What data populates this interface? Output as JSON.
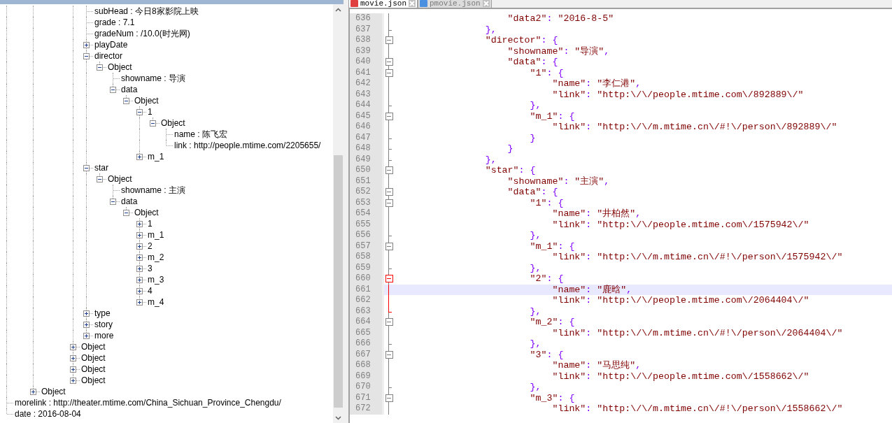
{
  "tree": [
    {
      "children": [
        {
          "children": [
            {
              "children": [
                {
                  "children": [
                    {
                      "children": [
                        {
                          "children": [
                            {
                              "label": "subHead : 今日8家影院上映"
                            },
                            {
                              "label": "grade : 7.1"
                            },
                            {
                              "label": "gradeNum : /10.0(时光网)"
                            },
                            {
                              "label": "playDate",
                              "expanded": false
                            },
                            {
                              "label": "director",
                              "expanded": true,
                              "children": [
                                {
                                  "label": "Object",
                                  "expanded": true,
                                  "children": [
                                    {
                                      "label": "showname : 导演"
                                    },
                                    {
                                      "label": "data",
                                      "expanded": true,
                                      "children": [
                                        {
                                          "label": "Object",
                                          "expanded": true,
                                          "children": [
                                            {
                                              "label": "1",
                                              "expanded": true,
                                              "children": [
                                                {
                                                  "label": "Object",
                                                  "expanded": true,
                                                  "children": [
                                                    {
                                                      "label": "name : 陈飞宏"
                                                    },
                                                    {
                                                      "label": "link : http://people.mtime.com/2205655/"
                                                    }
                                                  ]
                                                }
                                              ]
                                            },
                                            {
                                              "label": "m_1",
                                              "expanded": false
                                            }
                                          ]
                                        }
                                      ]
                                    }
                                  ]
                                }
                              ]
                            },
                            {
                              "label": "star",
                              "expanded": true,
                              "children": [
                                {
                                  "label": "Object",
                                  "expanded": true,
                                  "children": [
                                    {
                                      "label": "showname : 主演"
                                    },
                                    {
                                      "label": "data",
                                      "expanded": true,
                                      "children": [
                                        {
                                          "label": "Object",
                                          "expanded": true,
                                          "children": [
                                            {
                                              "label": "1",
                                              "expanded": false
                                            },
                                            {
                                              "label": "m_1",
                                              "expanded": false
                                            },
                                            {
                                              "label": "2",
                                              "expanded": false
                                            },
                                            {
                                              "label": "m_2",
                                              "expanded": false
                                            },
                                            {
                                              "label": "3",
                                              "expanded": false
                                            },
                                            {
                                              "label": "m_3",
                                              "expanded": false
                                            },
                                            {
                                              "label": "4",
                                              "expanded": false
                                            },
                                            {
                                              "label": "m_4",
                                              "expanded": false
                                            }
                                          ]
                                        }
                                      ]
                                    }
                                  ]
                                }
                              ]
                            },
                            {
                              "label": "type",
                              "expanded": false
                            },
                            {
                              "label": "story",
                              "expanded": false
                            },
                            {
                              "label": "more",
                              "expanded": false
                            }
                          ]
                        },
                        {
                          "label": "Object",
                          "expanded": false
                        },
                        {
                          "label": "Object",
                          "expanded": false
                        },
                        {
                          "label": "Object",
                          "expanded": false
                        },
                        {
                          "label": "Object",
                          "expanded": false
                        }
                      ]
                    }
                  ]
                }
              ]
            },
            {
              "label": "Object",
              "expanded": false
            }
          ]
        }
      ]
    },
    {
      "label": "morelink : http://theater.mtime.com/China_Sichuan_Province_Chengdu/"
    },
    {
      "label": "date : 2016-08-04"
    }
  ],
  "tabs": [
    {
      "label": "movie.json",
      "selected": true
    },
    {
      "label": "pmovie.json",
      "selected": false
    }
  ],
  "lines": [
    {
      "number": "636",
      "kind": "line",
      "text": "                    \"data2\": \"2016-8-5\""
    },
    {
      "number": "637",
      "kind": "end",
      "text": "                },"
    },
    {
      "number": "638",
      "kind": "box",
      "text": "                \"director\": {"
    },
    {
      "number": "639",
      "kind": "line",
      "text": "                    \"showname\": \"导演\","
    },
    {
      "number": "640",
      "kind": "box",
      "text": "                    \"data\": {"
    },
    {
      "number": "641",
      "kind": "box",
      "text": "                        \"1\": {"
    },
    {
      "number": "642",
      "kind": "line",
      "text": "                            \"name\": \"李仁港\","
    },
    {
      "number": "643",
      "kind": "line",
      "text": "                            \"link\": \"http:\\/\\/people.mtime.com\\/892889\\/\""
    },
    {
      "number": "644",
      "kind": "end",
      "text": "                        },"
    },
    {
      "number": "645",
      "kind": "box",
      "text": "                        \"m_1\": {"
    },
    {
      "number": "646",
      "kind": "line",
      "text": "                            \"link\": \"http:\\/\\/m.mtime.cn\\/#!\\/person\\/892889\\/\""
    },
    {
      "number": "647",
      "kind": "end",
      "text": "                        }"
    },
    {
      "number": "648",
      "kind": "end",
      "text": "                    }"
    },
    {
      "number": "649",
      "kind": "end",
      "text": "                },"
    },
    {
      "number": "650",
      "kind": "box",
      "text": "                \"star\": {"
    },
    {
      "number": "651",
      "kind": "line",
      "text": "                    \"showname\": \"主演\","
    },
    {
      "number": "652",
      "kind": "box",
      "text": "                    \"data\": {"
    },
    {
      "number": "653",
      "kind": "box",
      "text": "                        \"1\": {"
    },
    {
      "number": "654",
      "kind": "line",
      "text": "                            \"name\": \"井柏然\","
    },
    {
      "number": "655",
      "kind": "line",
      "text": "                            \"link\": \"http:\\/\\/people.mtime.com\\/1575942\\/\""
    },
    {
      "number": "656",
      "kind": "end",
      "text": "                        },"
    },
    {
      "number": "657",
      "kind": "box",
      "text": "                        \"m_1\": {"
    },
    {
      "number": "658",
      "kind": "line",
      "text": "                            \"link\": \"http:\\/\\/m.mtime.cn\\/#!\\/person\\/1575942\\/\""
    },
    {
      "number": "659",
      "kind": "end",
      "text": "                        },"
    },
    {
      "number": "660",
      "kind": "box",
      "highlight": true,
      "text": "                        \"2\": {"
    },
    {
      "number": "661",
      "kind": "line",
      "highlight": true,
      "current": true,
      "text": "                            \"name\": \"鹿晗\","
    },
    {
      "number": "662",
      "kind": "line",
      "highlight": true,
      "text": "                            \"link\": \"http:\\/\\/people.mtime.com\\/2064404\\/\""
    },
    {
      "number": "663",
      "kind": "end",
      "highlight": true,
      "text": "                        },"
    },
    {
      "number": "664",
      "kind": "box",
      "text": "                        \"m_2\": {"
    },
    {
      "number": "665",
      "kind": "line",
      "text": "                            \"link\": \"http:\\/\\/m.mtime.cn\\/#!\\/person\\/2064404\\/\""
    },
    {
      "number": "666",
      "kind": "end",
      "text": "                        },"
    },
    {
      "number": "667",
      "kind": "box",
      "text": "                        \"3\": {"
    },
    {
      "number": "668",
      "kind": "line",
      "text": "                            \"name\": \"马思纯\","
    },
    {
      "number": "669",
      "kind": "line",
      "text": "                            \"link\": \"http:\\/\\/people.mtime.com\\/1558662\\/\""
    },
    {
      "number": "670",
      "kind": "end",
      "text": "                        },"
    },
    {
      "number": "671",
      "kind": "box",
      "text": "                        \"m_3\": {"
    },
    {
      "number": "672",
      "kind": "line",
      "text": "                            \"link\": \"http:\\/\\/m.mtime.cn\\/#!\\/person\\/1558662\\/\""
    }
  ]
}
